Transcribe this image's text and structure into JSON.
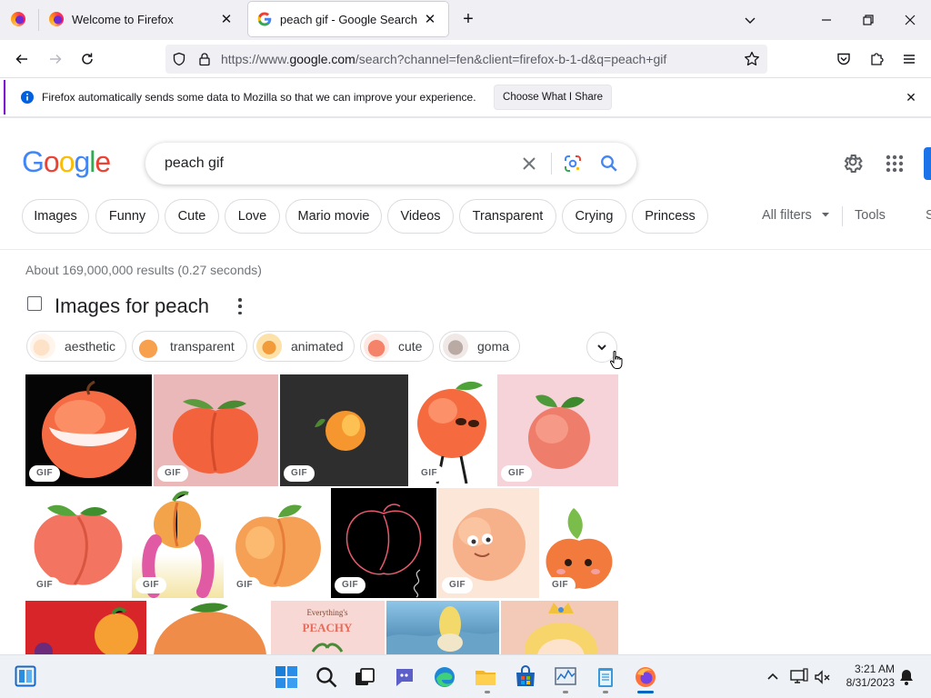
{
  "browser": {
    "tabs": [
      {
        "title": "Welcome to Firefox",
        "icon": "firefox-icon"
      },
      {
        "title": "peach gif - Google Search",
        "icon": "google-g-icon",
        "active": true
      }
    ],
    "new_tab": "+",
    "url_prefix": "https://www.",
    "url_domain": "google.com",
    "url_path": "/search?channel=fen&client=firefox-b-1-d&q=peach+gif"
  },
  "notification": {
    "text": "Firefox automatically sends some data to Mozilla so that we can improve your experience.",
    "button": "Choose What I Share"
  },
  "google": {
    "logo": [
      "G",
      "o",
      "o",
      "g",
      "l",
      "e"
    ],
    "logo_colors": [
      "#4285f4",
      "#ea4335",
      "#fbbc05",
      "#4285f4",
      "#34a853",
      "#ea4335"
    ],
    "query": "peach gif",
    "chips": [
      "Images",
      "Funny",
      "Cute",
      "Love",
      "Mario movie",
      "Videos",
      "Transparent",
      "Crying",
      "Princess"
    ],
    "all_filters": "All filters",
    "tools": "Tools",
    "tools_partial": "S",
    "result_stats": "About 169,000,000 results (0.27 seconds)",
    "images_heading": "Images for peach",
    "refinements": [
      "aesthetic",
      "transparent",
      "animated",
      "cute",
      "goma"
    ],
    "gif_badge": "GIF"
  },
  "taskbar": {
    "time": "3:21 AM",
    "date": "8/31/2023"
  }
}
